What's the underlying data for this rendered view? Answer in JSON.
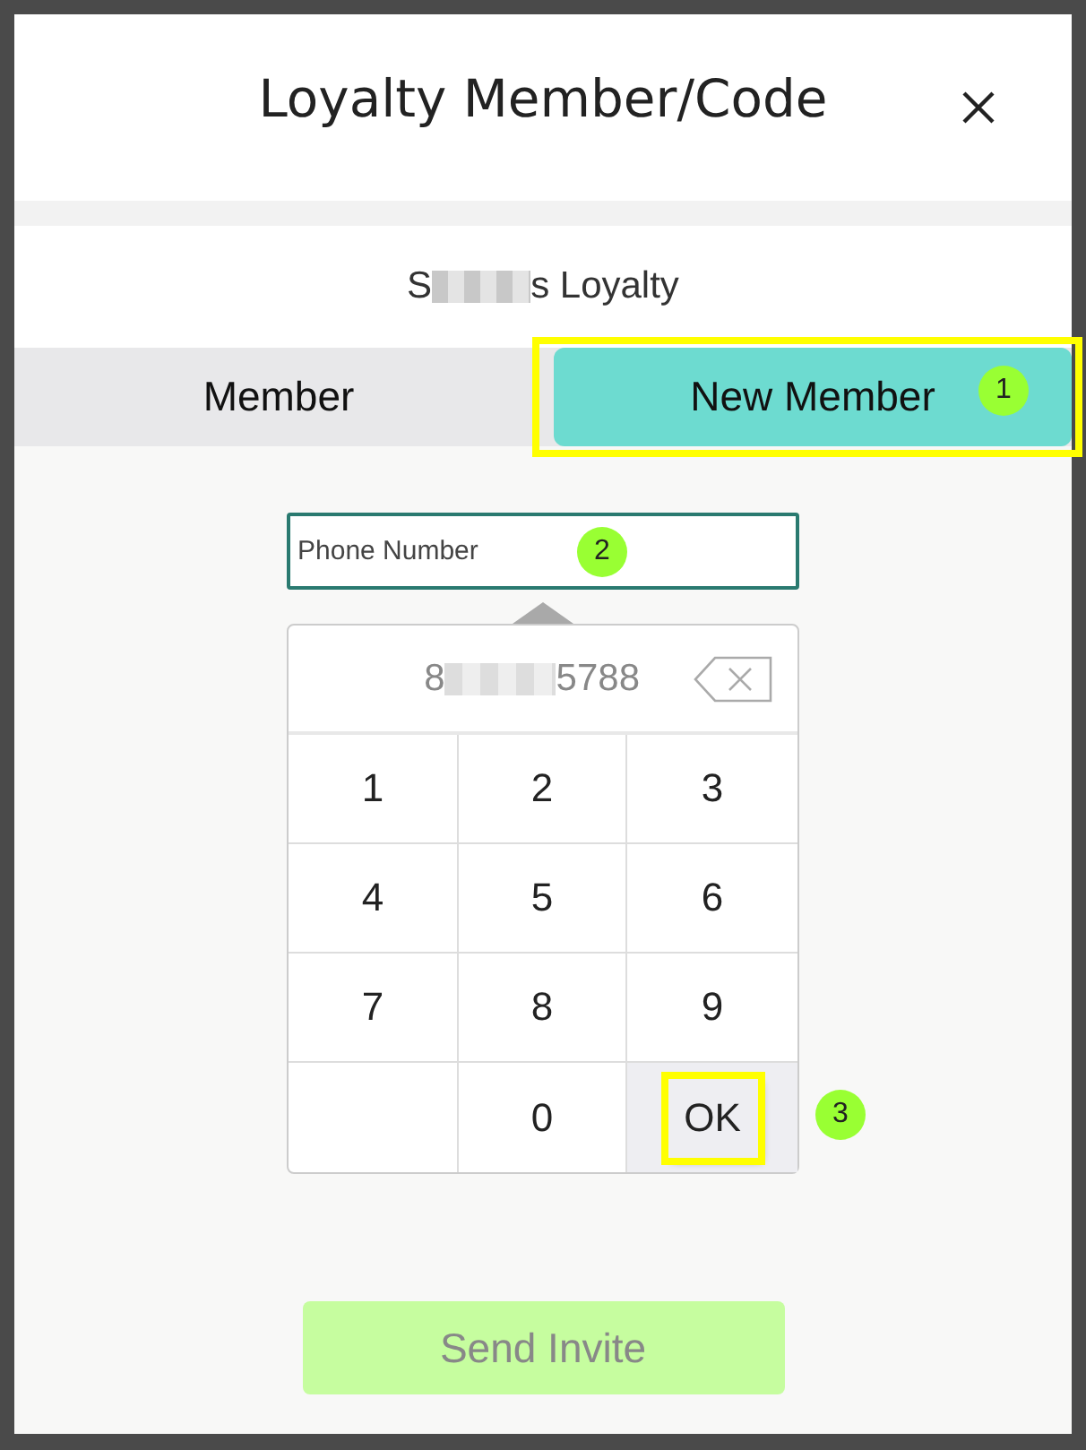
{
  "dialog": {
    "title": "Loyalty Member/Code",
    "program_name": {
      "start": "S",
      "end": "s Loyalty"
    }
  },
  "tabs": [
    {
      "label": "Member",
      "selected": false
    },
    {
      "label": "New Member",
      "selected": true,
      "callout": "1"
    }
  ],
  "phone_field": {
    "placeholder": "Phone Number",
    "callout": "2"
  },
  "keypad": {
    "entry": {
      "start": "8",
      "end": "5788"
    },
    "keys": [
      {
        "kind": "digit",
        "label": "1"
      },
      {
        "kind": "digit",
        "label": "2"
      },
      {
        "kind": "digit",
        "label": "3"
      },
      {
        "kind": "digit",
        "label": "4"
      },
      {
        "kind": "digit",
        "label": "5"
      },
      {
        "kind": "digit",
        "label": "6"
      },
      {
        "kind": "digit",
        "label": "7"
      },
      {
        "kind": "digit",
        "label": "8"
      },
      {
        "kind": "digit",
        "label": "9"
      },
      {
        "kind": "blank"
      },
      {
        "kind": "digit",
        "label": "0"
      },
      {
        "kind": "ok",
        "label": "OK",
        "callout": "3"
      }
    ]
  },
  "send_button": {
    "label": "Send Invite",
    "disabled": true
  }
}
